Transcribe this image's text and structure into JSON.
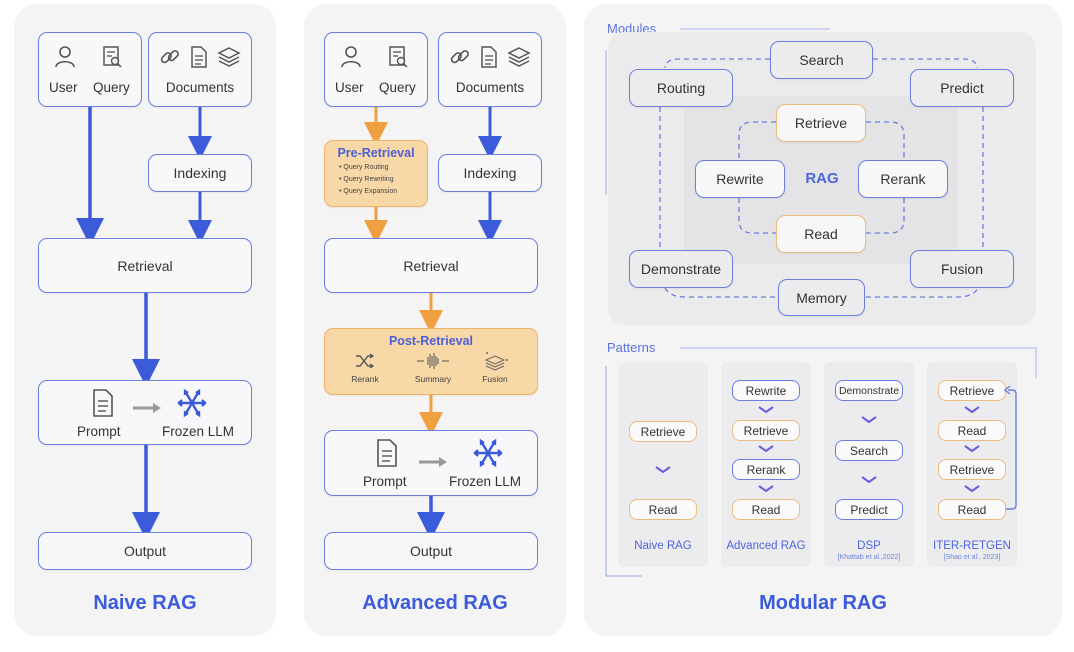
{
  "naive": {
    "title": "Naive RAG",
    "user_label": "User",
    "query_label": "Query",
    "documents_label": "Documents",
    "indexing_label": "Indexing",
    "retrieval_label": "Retrieval",
    "prompt_label": "Prompt",
    "llm_label": "Frozen LLM",
    "output_label": "Output"
  },
  "advanced": {
    "title": "Advanced RAG",
    "user_label": "User",
    "query_label": "Query",
    "documents_label": "Documents",
    "indexing_label": "Indexing",
    "pre_retrieval": {
      "title": "Pre-Retrieval",
      "items": [
        "Query Routing",
        "Query Rewriting",
        "Query Expansion"
      ]
    },
    "retrieval_label": "Retrieval",
    "post_retrieval": {
      "title": "Post-Retrieval",
      "items": [
        "Rerank",
        "Summary",
        "Fusion"
      ]
    },
    "prompt_label": "Prompt",
    "llm_label": "Frozen LLM",
    "output_label": "Output"
  },
  "modular": {
    "title": "Modular RAG",
    "modules_label": "Modules",
    "patterns_label": "Patterns",
    "outer_modules": [
      "Search",
      "Routing",
      "Predict",
      "Demonstrate",
      "Fusion",
      "Memory"
    ],
    "center_label": "RAG",
    "inner_modules": [
      "Retrieve",
      "Rewrite",
      "Rerank",
      "Read"
    ],
    "patterns": [
      {
        "name": "Naive RAG",
        "cite": "",
        "steps": [
          {
            "label": "Retrieve",
            "color": "orange"
          },
          {
            "label": "Read",
            "color": "orange"
          }
        ]
      },
      {
        "name": "Advanced RAG",
        "cite": "",
        "steps": [
          {
            "label": "Rewrite",
            "color": "blue"
          },
          {
            "label": "Retrieve",
            "color": "orange"
          },
          {
            "label": "Rerank",
            "color": "blue"
          },
          {
            "label": "Read",
            "color": "orange"
          }
        ]
      },
      {
        "name": "DSP",
        "cite": "[Khattab et al.,2022]",
        "steps": [
          {
            "label": "Demonstrate",
            "color": "blue"
          },
          {
            "label": "Search",
            "color": "blue"
          },
          {
            "label": "Predict",
            "color": "blue"
          }
        ]
      },
      {
        "name": "ITER-RETGEN",
        "cite": "[Shao et al., 2023]",
        "steps": [
          {
            "label": "Retrieve",
            "color": "orange"
          },
          {
            "label": "Read",
            "color": "orange"
          },
          {
            "label": "Retrieve",
            "color": "orange"
          },
          {
            "label": "Read",
            "color": "orange"
          }
        ]
      }
    ]
  },
  "colors": {
    "blue": "#3b5bdb",
    "box_border": "#6b7fe0",
    "orange": "#f0a040",
    "orange_fill": "#f8d8a6"
  }
}
